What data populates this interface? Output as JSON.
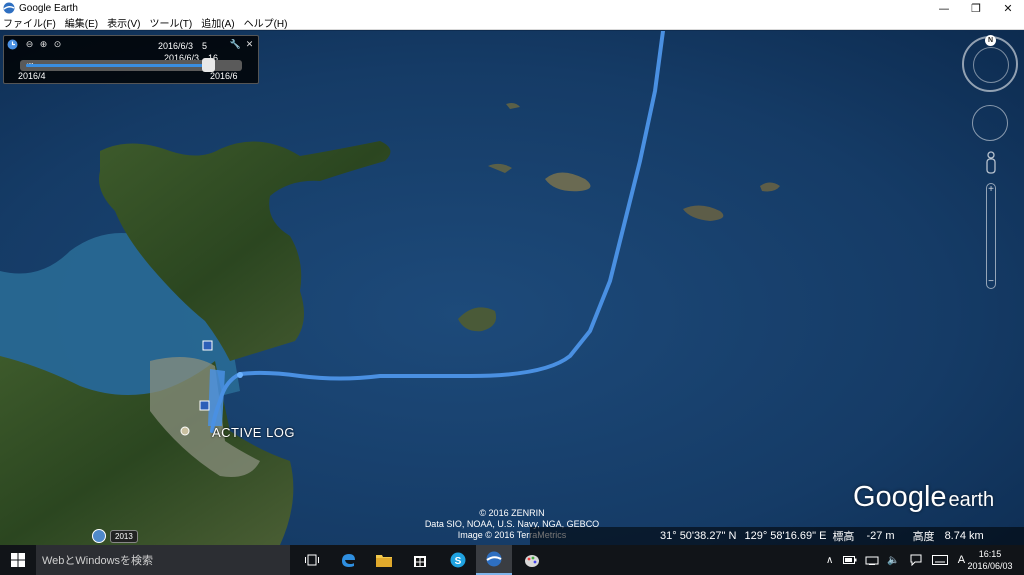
{
  "window": {
    "title": "Google Earth",
    "icon": "google-earth-icon",
    "controls": {
      "minimize": "—",
      "maximize": "❐",
      "close": "✕"
    }
  },
  "menu": [
    "ファイル(F)",
    "編集(E)",
    "表示(V)",
    "ツール(T)",
    "追加(A)",
    "ヘルプ(H)"
  ],
  "time_slider": {
    "current_date": "2016/6/3　5",
    "current_date_2": "2016/6/3　16",
    "range_start": "2016/4",
    "range_end": "2016/6",
    "progress_fraction": 0.93,
    "icons": [
      "clock-icon",
      "zoom-out-icon",
      "zoom-in-icon",
      "animate-icon",
      "settings-wrench-icon",
      "close-icon"
    ],
    "close_glyph": "✕"
  },
  "map": {
    "track_label": "ACTIVE LOG",
    "track_color": "#4a90e2",
    "attribution": [
      "© 2016 ZENRIN",
      "Data SIO, NOAA, U.S. Navy, NGA, GEBCO",
      "Image © 2016 TerraMetrics"
    ],
    "logo_main": "Google",
    "logo_sub": "earth",
    "historical_year": "2013",
    "compass_letter": "N"
  },
  "status_bar": {
    "lat": "31°  50'38.27\" N",
    "lon": "129°  58'16.69\" E",
    "elevation_label": "標高",
    "elevation_value": "-27 m",
    "altitude_label": "高度",
    "altitude_value": "8.74 km"
  },
  "taskbar": {
    "search_placeholder": "WebとWindowsを検索",
    "apps": [
      "task-view-icon",
      "edge-icon",
      "file-explorer-icon",
      "store-icon",
      "skype-icon",
      "google-earth-icon",
      "paint-icon"
    ],
    "tray_ime": "A",
    "clock_time": "16:15",
    "clock_date": "2016/06/03"
  }
}
